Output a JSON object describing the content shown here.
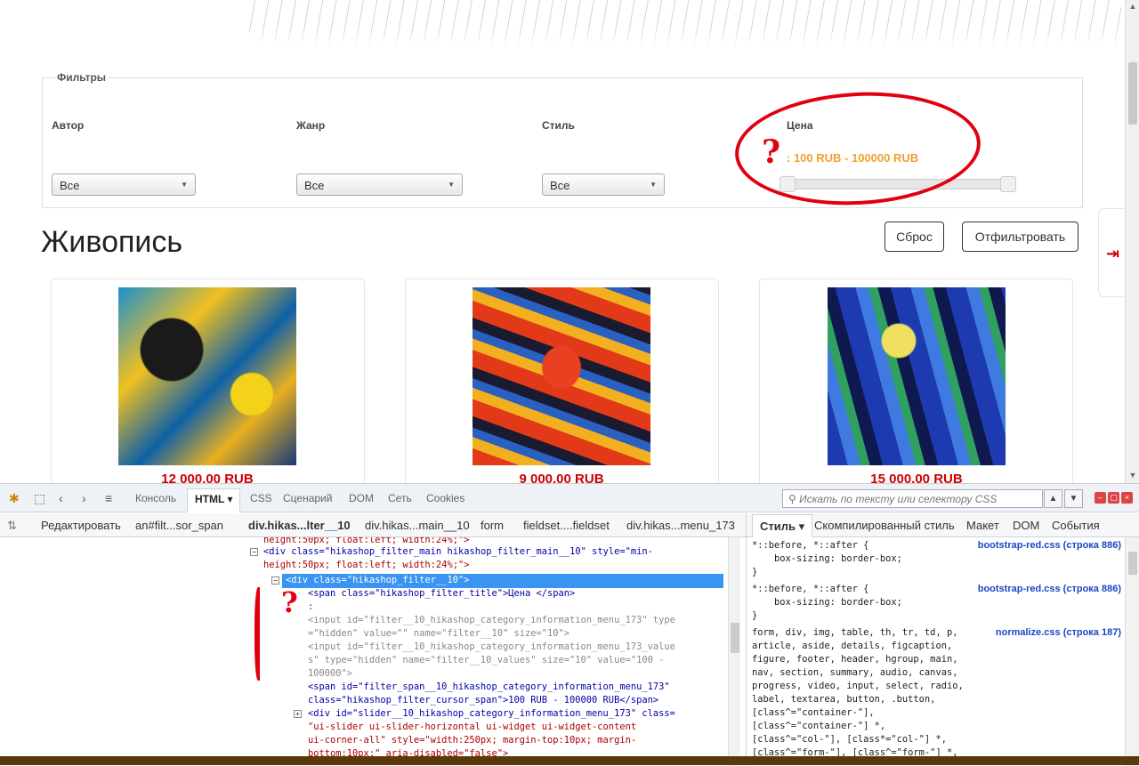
{
  "filters": {
    "legend": "Фильтры",
    "author": {
      "label": "Автор",
      "value": "Все"
    },
    "genre": {
      "label": "Жанр",
      "value": "Все"
    },
    "style": {
      "label": "Стиль",
      "value": "Все"
    },
    "price": {
      "label": "Цена",
      "range_text": ": 100 RUB - 100000 RUB",
      "slider_min": 0,
      "slider_max": 1
    }
  },
  "section_title": "Живопись",
  "buttons": {
    "reset": "Сброс",
    "filter": "Отфильтровать"
  },
  "products": [
    {
      "price": "12 000,00 RUB"
    },
    {
      "price": "9 000,00 RUB"
    },
    {
      "price": "15 000,00 RUB"
    }
  ],
  "annotation": {
    "question_mark": "?"
  },
  "devtools": {
    "tabs": [
      "Консоль",
      "HTML",
      "CSS",
      "Сценарий",
      "DOM",
      "Сеть",
      "Cookies"
    ],
    "active_tab": "HTML",
    "search_placeholder": "Искать по тексту или селектору CSS",
    "edit_label": "Редактировать",
    "breadcrumbs": [
      "an#filt...sor_span",
      "div.hikas...lter__10",
      "div.hikas...main__10",
      "form",
      "fieldset....fieldset",
      "div.hikas...menu_173"
    ],
    "right_tabs": [
      "Стиль",
      "Скомпилированный стиль",
      "Макет",
      "DOM",
      "События"
    ],
    "code_lines": [
      "height:50px; float:left; width:24%;\">",
      "<div class=\"hikashop_filter_main hikashop_filter_main__10\" style=\"min-",
      "height:50px; float:left; width:24%;\">",
      "<div class=\"hikashop_filter__10\">",
      "<span class=\"hikashop_filter_title\">Цена </span>",
      ":",
      "<input id=\"filter__10_hikashop_category_information_menu_173\" type",
      "=\"hidden\" value=\"\" name=\"filter__10\" size=\"10\">",
      "<input id=\"filter__10_hikashop_category_information_menu_173_value",
      "s\" type=\"hidden\" name=\"filter__10_values\" size=\"10\" value=\"100 -",
      "100000\">",
      "<span id=\"filter_span__10_hikashop_category_information_menu_173\"",
      "class=\"hikashop_filter_cursor_span\">100 RUB - 100000 RUB</span>",
      "<div id=\"slider__10_hikashop_category_information_menu_173\" class=",
      "\"ui-slider ui-slider-horizontal ui-widget ui-widget-content",
      "ui-corner-all\" style=\"width:250px; margin-top:10px; margin-",
      "bottom:10px;\" aria-disabled=\"false\">"
    ],
    "css_rules": [
      {
        "lines": [
          "*::before, *::after {",
          "    box-sizing: border-box;",
          "}"
        ],
        "source": "bootstrap-red.css (строка 886)"
      },
      {
        "lines": [
          "*::before, *::after {",
          "    box-sizing: border-box;",
          "}"
        ],
        "source": "bootstrap-red.css (строка 886)"
      },
      {
        "lines": [
          "form, div, img, table, th, tr, td, p,",
          "article, aside, details, figcaption,",
          "figure, footer, header, hgroup, main,",
          "nav, section, summary, audio, canvas,",
          "progress, video, input, select, radio,",
          "label, textarea, button, .button,",
          "[class^=\"container-\"],",
          "[class^=\"container-\"] *,",
          "[class^=\"col-\"], [class*=\"col-\"] *,",
          "[class^=\"form-\"], [class^=\"form-\"] *,"
        ],
        "source": "normalize.css (строка 187)"
      }
    ]
  }
}
